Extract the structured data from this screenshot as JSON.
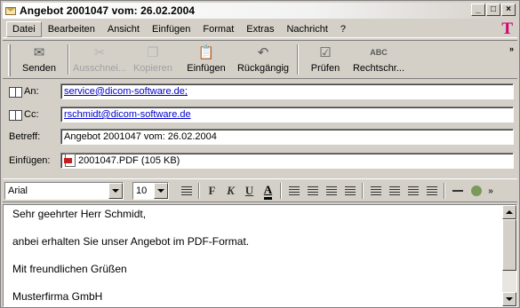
{
  "window": {
    "title": "Angebot  2001047 vom: 26.02.2004",
    "minimize": "_",
    "maximize": "□",
    "close": "×"
  },
  "menu": {
    "items": [
      "Datei",
      "Bearbeiten",
      "Ansicht",
      "Einfügen",
      "Format",
      "Extras",
      "Nachricht",
      "?"
    ],
    "brand": "T"
  },
  "toolbar": {
    "buttons": [
      {
        "label": "Senden",
        "icon": "send-icon",
        "glyph": "✉"
      },
      {
        "label": "Ausschnei...",
        "icon": "scissors-icon",
        "glyph": "✂",
        "disabled": true
      },
      {
        "label": "Kopieren",
        "icon": "copy-icon",
        "glyph": "❐",
        "disabled": true
      },
      {
        "label": "Einfügen",
        "icon": "paste-icon",
        "glyph": "📋"
      },
      {
        "label": "Rückgängig",
        "icon": "undo-icon",
        "glyph": "↶"
      },
      {
        "label": "Prüfen",
        "icon": "check-names-icon",
        "glyph": "☑"
      },
      {
        "label": "Rechtschr...",
        "icon": "spellcheck-icon",
        "glyph": "ABC"
      }
    ],
    "overflow": "»"
  },
  "header": {
    "to": {
      "label": "An:",
      "value": "service@dicom-software.de;"
    },
    "cc": {
      "label": "Cc:",
      "value": "rschmidt@dicom-software.de"
    },
    "subject": {
      "label": "Betreff:",
      "value": "Angebot  2001047 vom: 26.02.2004"
    },
    "attachment": {
      "label": "Einfügen:",
      "value": "2001047.PDF (105 KB)"
    }
  },
  "format": {
    "font": "Arial",
    "size": "10",
    "bold": "F",
    "italic": "K",
    "underline": "U",
    "overflow": "»"
  },
  "body": {
    "lines": [
      "Sehr geehrter Herr Schmidt,",
      "anbei erhalten Sie unser Angebot im PDF-Format.",
      "Mit freundlichen Grüßen",
      "Musterfirma GmbH"
    ]
  }
}
